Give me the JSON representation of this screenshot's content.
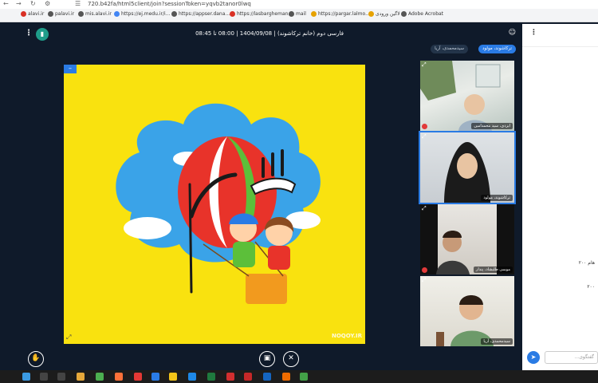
{
  "browser": {
    "url": "720.b42fa/html5client/join?sessionToken=yqvb2tanor0lwq",
    "bookmarks": [
      {
        "label": "alavi.ir",
        "color": "#d93025"
      },
      {
        "label": "palavi.ir",
        "color": "#555555"
      },
      {
        "label": "mis.alavi.ir",
        "color": "#555555"
      },
      {
        "label": "https://ej.medu.ir/i...",
        "color": "#4285f4"
      },
      {
        "label": "https://appser.dana...",
        "color": "#555555"
      },
      {
        "label": "https://lasbargheman...",
        "color": "#d93025"
      },
      {
        "label": "mail",
        "color": "#555555"
      },
      {
        "label": "https://pargar.lalmo...",
        "color": "#e6a200"
      },
      {
        "label": "لاگین ورودی",
        "color": "#e6a200"
      },
      {
        "label": "Adobe Acrobat",
        "color": "#555555"
      }
    ]
  },
  "meeting": {
    "title": "فارسی دوم (خانم ترکاشوند) | 1404/09/08 | 08:00 تا 08:45"
  },
  "presentation": {
    "watermark": "NOQOY.IR"
  },
  "webcams": {
    "pill_active": "ترکاشوند، مولود",
    "pill_second": "سیدمحمدی، آریا",
    "cams": [
      {
        "name": "ایزدی، سید محمدامین"
      },
      {
        "name": "ترکاشوند، مولود"
      },
      {
        "name": "موسی طلبشاد، پندار"
      },
      {
        "name": "سیدمحمدی، آریا"
      }
    ]
  },
  "chat": {
    "messages": [
      "هام ۲۰۰",
      "۲۰۰"
    ],
    "input_placeholder": "...گفتگوی"
  },
  "colors": {
    "accent": "#2a7be4",
    "stage_bg": "#0f1a2a",
    "slide_bg": "#f9e20f"
  }
}
